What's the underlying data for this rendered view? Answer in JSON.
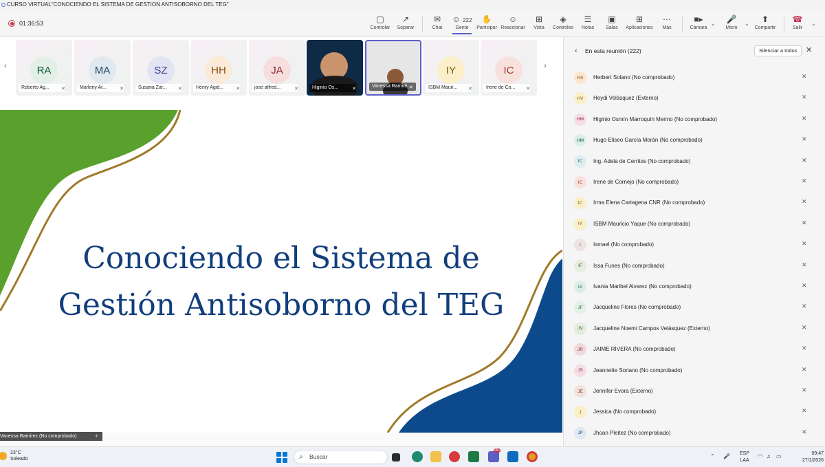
{
  "window": {
    "title": "CURSO VIRTUAL\"CONOCIENDO EL SISTEMA DE GESTION ANTISOBORNO DEL TEG\""
  },
  "meeting": {
    "elapsed": "01:36:53"
  },
  "toolbar": {
    "controlar": "Controlar",
    "separar": "Separar",
    "chat": "Chat",
    "gente": "Gente",
    "gente_count": "222",
    "participar": "Participar",
    "reaccionar": "Reaccionar",
    "vista": "Vista",
    "controles": "Controles",
    "notas": "Notas",
    "salas": "Salas",
    "aplicaciones": "Aplicaciones",
    "mas": "Más",
    "camara": "Cámara",
    "micro": "Micro",
    "compartir": "Compartir",
    "salir": "Salir"
  },
  "tiles": [
    {
      "initials": "RA",
      "name": "Roberto Ag...",
      "bg": "#e2efe6",
      "fg": "#0f5a3a"
    },
    {
      "initials": "MA",
      "name": "Marleny Ar...",
      "bg": "#dfe9ef",
      "fg": "#204a66"
    },
    {
      "initials": "SZ",
      "name": "Susana Zar...",
      "bg": "#e3e4f3",
      "fg": "#3b3f8c"
    },
    {
      "initials": "HH",
      "name": "Henry Agid...",
      "bg": "#fbead7",
      "fg": "#8a4a12"
    },
    {
      "initials": "JA",
      "name": "jose alfred...",
      "bg": "#f6dede",
      "fg": "#8a2a2a"
    },
    {
      "initials": "",
      "name": "Higinio Os..."
    },
    {
      "initials": "",
      "name": "Vanessa Ramire..."
    },
    {
      "initials": "IY",
      "name": "ISBM Mauri...",
      "bg": "#fbefc9",
      "fg": "#7a5a00"
    },
    {
      "initials": "IC",
      "name": "Irene de Co...",
      "bg": "#f8e1dc",
      "fg": "#9a3a2a"
    }
  ],
  "slide": {
    "line1": "Conociendo el Sistema de",
    "line2": "Gestión Antisoborno del TEG",
    "presenter_tag": "Vanessa Ramírez (No comprobado)"
  },
  "panel": {
    "title": "En esta reunión (222)",
    "mute_all": "Silenciar a todos",
    "participants": [
      {
        "initials": "HS",
        "name": "Herbert Solano (No comprobado)",
        "bg": "#fbe6cf",
        "fg": "#8a4a12"
      },
      {
        "initials": "HV",
        "name": "Heydi Velásquez (Externo)",
        "bg": "#fbefc9",
        "fg": "#7a5a00"
      },
      {
        "initials": "HM",
        "name": "Higinio Osmín Marroquín Merino (No comprobado)",
        "bg": "#f6dde3",
        "fg": "#8a2a45"
      },
      {
        "initials": "HM",
        "name": "Hugo Eliseo García Morán (No comprobado)",
        "bg": "#dcefe6",
        "fg": "#0f5a3a"
      },
      {
        "initials": "IC",
        "name": "Ing. Adela de Cerritos (No comprobado)",
        "bg": "#ddeef0",
        "fg": "#1d5a60"
      },
      {
        "initials": "IC",
        "name": "Irene de Cornejo (No comprobado)",
        "bg": "#f8e1dc",
        "fg": "#9a3a2a"
      },
      {
        "initials": "IC",
        "name": "Irma Elena Cartagena CNR (No comprobado)",
        "bg": "#fbefc9",
        "fg": "#7a5a00"
      },
      {
        "initials": "IY",
        "name": "ISBM Mauricio Yaque (No comprobado)",
        "bg": "#fbefc9",
        "fg": "#7a5a00"
      },
      {
        "initials": "I",
        "name": "Ismael (No comprobado)",
        "bg": "#efe2e2",
        "fg": "#6a3a3a"
      },
      {
        "initials": "IF",
        "name": "Issa Funes (No comprobado)",
        "bg": "#e6ecdf",
        "fg": "#3f5a2a"
      },
      {
        "initials": "IA",
        "name": "Ivania Maribel Alvarez (No comprobado)",
        "bg": "#dcefe6",
        "fg": "#0f5a3a"
      },
      {
        "initials": "JF",
        "name": "Jacqueline Flores (No comprobado)",
        "bg": "#e2f1e6",
        "fg": "#2f6a3a"
      },
      {
        "initials": "JV",
        "name": "Jacqueline Noemi Campos Velásquez (Externo)",
        "bg": "#e3ecdf",
        "fg": "#3f5a2a"
      },
      {
        "initials": "JR",
        "name": "JAIME RIVERA (No comprobado)",
        "bg": "#f2d9dc",
        "fg": "#8a2a35"
      },
      {
        "initials": "JS",
        "name": "Jeannette Soriano (No comprobado)",
        "bg": "#f6dde3",
        "fg": "#8a2a45"
      },
      {
        "initials": "JE",
        "name": "Jennifer Evora (Externo)",
        "bg": "#f3e1dc",
        "fg": "#7a3a2a"
      },
      {
        "initials": "J",
        "name": "Jessica (No comprobado)",
        "bg": "#fbefc9",
        "fg": "#7a5a00"
      },
      {
        "initials": "JP",
        "name": "Jhoan Pleitez (No comprobado)",
        "bg": "#dfe9f3",
        "fg": "#204a7a"
      }
    ]
  },
  "taskbar": {
    "temp": "23°C",
    "weather": "Soleado",
    "search_placeholder": "Buscar",
    "lang1": "ESP",
    "lang2": "LAA",
    "time": "09:47",
    "date": "27/1/2026",
    "teams_badge": "99+"
  },
  "colors": {
    "slide_title": "#123f7c",
    "slide_green": "#5aa02c",
    "slide_blue": "#0d4a8c",
    "slide_gold": "#a07a2a",
    "teams_accent": "#5b5fc7"
  }
}
